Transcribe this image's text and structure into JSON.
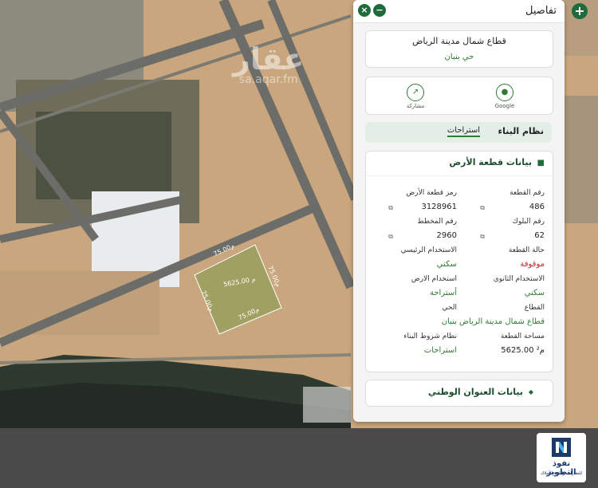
{
  "map": {
    "watermark_ar": "عقار",
    "watermark_url": "sa.aqar.fm",
    "dims": {
      "top": "75.00م",
      "bottom": "75.00م",
      "left": "75.00م",
      "right": "75.00م",
      "area": "5625.00 م"
    }
  },
  "controls": {
    "add": "+",
    "close": "×",
    "minimize": "−"
  },
  "panel": {
    "title": "تفاصيل",
    "location": {
      "sector": "قطاع شمال مدينة الرياض",
      "district": "حي بنبان"
    },
    "actions": [
      {
        "label": "Google",
        "icon": "map-pin-icon"
      },
      {
        "label": "مشاركة",
        "icon": "share-icon"
      }
    ],
    "tab": {
      "label": "نظام البناء",
      "value": "استراحات"
    },
    "parcel": {
      "title": "بيانات قطعة الأرض",
      "parcel_number_label": "رقم القطعة",
      "parcel_number": "486",
      "parcel_code_label": "رمز قطعة الأرض",
      "parcel_code": "3128961",
      "block_label": "رقم البلوك",
      "block": "62",
      "plan_label": "رقم المخطط",
      "plan": "2960",
      "status_label": "حالة القطعة",
      "status": "موقوفة",
      "main_use_label": "الاستخدام الرئيسي",
      "main_use": "سكني",
      "secondary_use_label": "الاستخدام الثانوي",
      "secondary_use": "سكني",
      "land_use_label": "استخدام الارض",
      "land_use": "أستراحة",
      "sector_label": "القطاع",
      "sector": "قطاع شمال مدينة الرياض",
      "district_label": "الحي",
      "district": "بنبان",
      "area_label": "مساحة القطعة",
      "area": "5625.00 م²",
      "building_rules_label": "نظام شروط البناء",
      "building_rules": "استراحات"
    },
    "address_title": "بيانات العنوان الوطني"
  },
  "logo": {
    "name": "نفوذ التطوير",
    "tagline": "للعقارات وإدارة الأملاك"
  },
  "colors": {
    "brand_green": "#1f6b3a",
    "status_red": "#c62828",
    "logo_navy": "#1b3a6b"
  }
}
